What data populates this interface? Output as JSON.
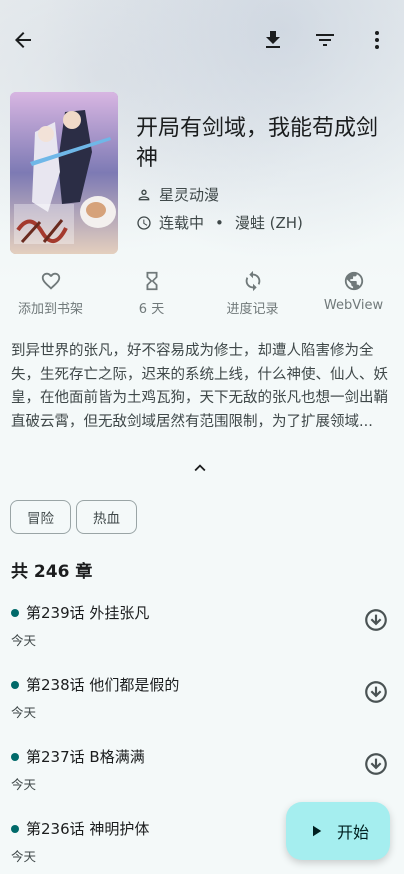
{
  "topbar": {
    "back_icon": "arrow-back-icon",
    "download_icon": "download-icon",
    "filter_icon": "filter-icon",
    "more_icon": "more-vert-icon"
  },
  "manga": {
    "title": "开局有剑域，我能苟成剑神",
    "author": "星灵动漫",
    "status": "连载中",
    "separator": "•",
    "source": "漫蛙 (ZH)"
  },
  "actions": [
    {
      "label": "添加到书架",
      "icon": "heart-outline-icon"
    },
    {
      "label": "6 天",
      "icon": "hourglass-icon"
    },
    {
      "label": "进度记录",
      "icon": "sync-icon"
    },
    {
      "label": "WebView",
      "icon": "globe-icon"
    }
  ],
  "description": "到异世界的张凡，好不容易成为修士，却遭人陷害修为全失，生死存亡之际，迟来的系统上线，什么神使、仙人、妖皇，在他面前皆为土鸡瓦狗，天下无敌的张凡也想一剑出鞘直破云霄，但无敌剑域居然有范围限制，为了扩展领域...",
  "genres": [
    "冒险",
    "热血"
  ],
  "chapter_count": "共 246 章",
  "chapters": [
    {
      "name": "第239话 外挂张凡",
      "date": "今天"
    },
    {
      "name": "第238话 他们都是假的",
      "date": "今天"
    },
    {
      "name": "第237话 B格满满",
      "date": "今天"
    },
    {
      "name": "第236话 神明护体",
      "date": "今天"
    }
  ],
  "fab": {
    "label": "开始",
    "icon": "play-icon"
  },
  "colors": {
    "accent": "#006a6a",
    "fab_bg": "#a5eeef",
    "background": "#f4f9f9"
  }
}
